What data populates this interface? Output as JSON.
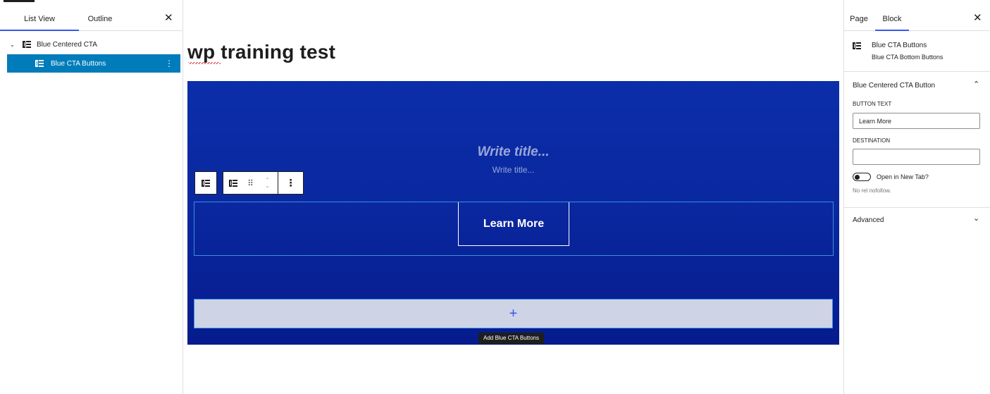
{
  "left_panel": {
    "tabs": [
      "List View",
      "Outline"
    ],
    "tree": [
      {
        "label": "Blue Centered CTA",
        "icon": "block-columns-icon"
      },
      {
        "label": "Blue CTA Buttons",
        "icon": "block-columns-icon",
        "selected": true
      }
    ]
  },
  "canvas": {
    "doc_title": "wp training test",
    "cta_title": "Write title...",
    "cta_subtitle": "Write title...",
    "button_label": "Learn More",
    "appender_symbol": "+",
    "tooltip": "Add Blue CTA Buttons",
    "colors": {
      "cta_bg": "#0a28a0",
      "appender_bg": "#ced3e6",
      "accent": "#3858e9",
      "selection": "#007cba"
    }
  },
  "toolbar": {
    "drag_glyph": "⠿",
    "up_glyph": "⌃",
    "down_glyph": "⌄",
    "more_glyph": "⋮"
  },
  "right_panel": {
    "tabs": [
      "Page",
      "Block"
    ],
    "block_name": "Blue CTA Buttons",
    "block_description": "Blue CTA Bottom Buttons",
    "section_title": "Blue Centered CTA Button",
    "button_text_label": "BUTTON TEXT",
    "button_text_value": "Learn More",
    "destination_label": "DESTINATION",
    "destination_value": "",
    "toggle_label": "Open in New Tab?",
    "help_text": "No rel nofollow.",
    "advanced_title": "Advanced"
  },
  "glyphs": {
    "close": "✕",
    "chevron_up": "⌃",
    "chevron_down": "⌄",
    "chevron_expand": "⌄"
  }
}
